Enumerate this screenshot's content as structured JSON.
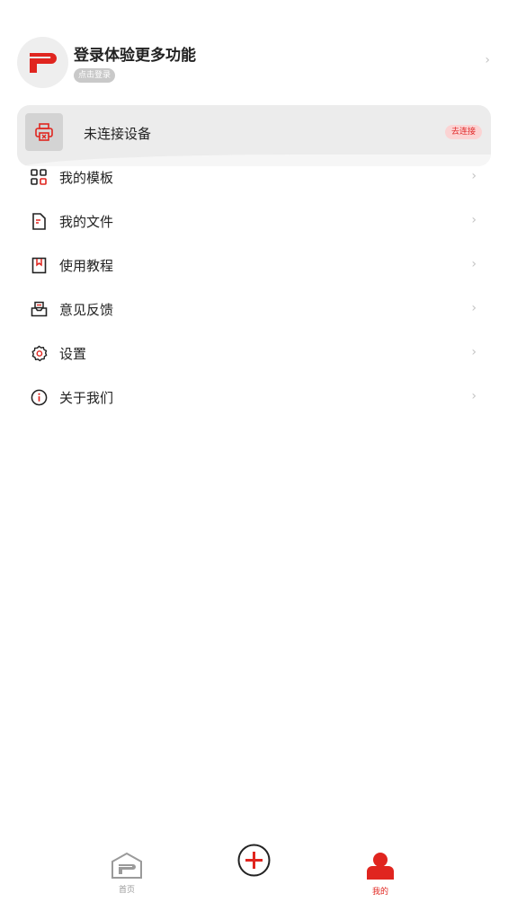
{
  "header": {
    "login_title": "登录体验更多功能",
    "login_badge": "点击登录",
    "logo_icon": "brand-p-logo",
    "brand_color": "#e0251f"
  },
  "device": {
    "label": "未连接设备",
    "connect_label": "去连接",
    "icon": "printer-disconnected-icon"
  },
  "menu": {
    "items": [
      {
        "label": "我的模板",
        "icon": "grid-icon"
      },
      {
        "label": "我的文件",
        "icon": "file-icon"
      },
      {
        "label": "使用教程",
        "icon": "bookmark-book-icon"
      },
      {
        "label": "意见反馈",
        "icon": "feedback-inbox-icon"
      },
      {
        "label": "设置",
        "icon": "gear-icon"
      },
      {
        "label": "关于我们",
        "icon": "info-icon"
      }
    ]
  },
  "nav": {
    "home_label": "首页",
    "mine_label": "我的",
    "active_color": "#e0251f",
    "inactive_color": "#9a9a9a"
  }
}
